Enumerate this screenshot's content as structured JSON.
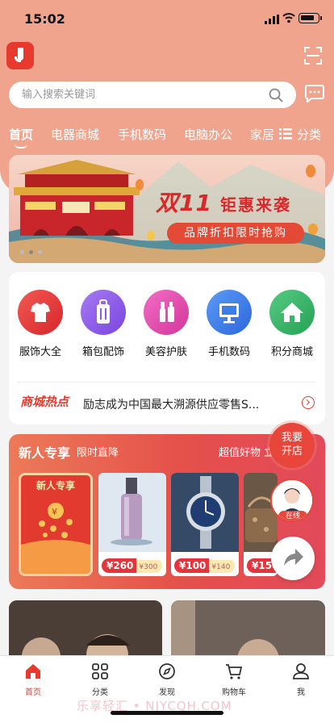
{
  "status_bar": {
    "time": "15:02"
  },
  "search": {
    "placeholder": "输入搜索关键词"
  },
  "tabs": [
    {
      "label": "首页"
    },
    {
      "label": "电器商城"
    },
    {
      "label": "手机数码"
    },
    {
      "label": "电脑办公"
    },
    {
      "label": "家居"
    }
  ],
  "category_button": {
    "label": "分类"
  },
  "banner": {
    "title": "双11",
    "subtitle": "钜惠来袭",
    "pill": "品牌折扣限时抢购"
  },
  "quick_links": [
    {
      "label": "服饰大全",
      "icon": "tshirt-icon",
      "color": "#e8403e"
    },
    {
      "label": "箱包配饰",
      "icon": "luggage-icon",
      "color": "#8b5be8"
    },
    {
      "label": "美容护肤",
      "icon": "cosmetics-icon",
      "color": "#e54fae"
    },
    {
      "label": "手机数码",
      "icon": "monitor-icon",
      "color": "#3a7ee8"
    },
    {
      "label": "积分商城",
      "icon": "home-icon",
      "color": "#35b46a"
    }
  ],
  "hot_news": {
    "badge": "商城热点",
    "text": "励志成为中国最大溯源供应零售S..."
  },
  "newbie": {
    "title": "新人专享",
    "subtitle": "限时直降",
    "more": "超值好物 立",
    "ribbon": "新人专享",
    "products": [
      {
        "price": "¥260",
        "old_price": "¥300"
      },
      {
        "price": "¥100",
        "old_price": "¥140"
      },
      {
        "price": "¥150",
        "old_price": ""
      }
    ]
  },
  "floating": {
    "open_store": [
      "我要",
      "开店"
    ],
    "online": "在线"
  },
  "tabbar": [
    {
      "label": "首页",
      "icon": "home-icon",
      "active": true
    },
    {
      "label": "分类",
      "icon": "grid-icon",
      "active": false
    },
    {
      "label": "发现",
      "icon": "compass-icon",
      "active": false
    },
    {
      "label": "购物车",
      "icon": "cart-icon",
      "active": false
    },
    {
      "label": "我",
      "icon": "user-icon",
      "active": false
    }
  ],
  "watermark": "乐享轻汇 • NJYCQH.COM",
  "colors": {
    "brand": "#e8392e",
    "header": "#f0a48e"
  }
}
